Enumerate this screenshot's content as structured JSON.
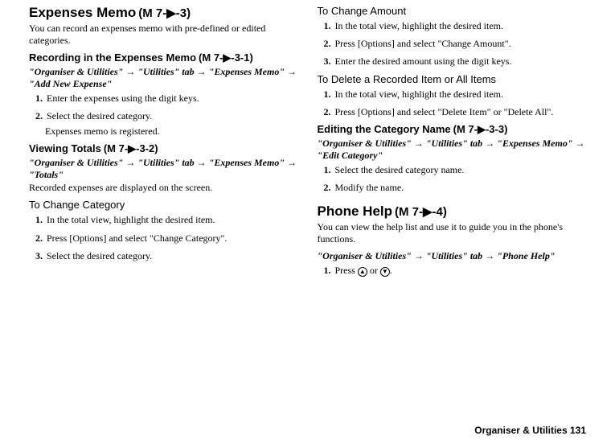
{
  "left": {
    "title": "Expenses Memo",
    "title_code": "(M 7-▶-3)",
    "intro": "You can record an expenses memo with pre-defined or edited categories.",
    "sec1": {
      "heading": "Recording in the Expenses Memo",
      "code": "(M 7-▶-3-1)",
      "path": "\"Organiser & Utilities\" → \"Utilities\" tab → \"Expenses Memo\" → \"Add New Expense\"",
      "steps": [
        "Enter the expenses using the digit keys.",
        "Select the desired category."
      ],
      "note": "Expenses memo is registered."
    },
    "sec2": {
      "heading": "Viewing Totals",
      "code": "(M 7-▶-3-2)",
      "path": "\"Organiser & Utilities\" → \"Utilities\" tab → \"Expenses Memo\" → \"Totals\"",
      "after": "Recorded expenses are displayed on the screen."
    },
    "sec3": {
      "heading": "To Change Category",
      "steps": [
        "In the total view, highlight the desired item.",
        "Press [Options] and select \"Change Category\".",
        "Select the desired category."
      ]
    }
  },
  "right": {
    "sec1": {
      "heading": "To Change Amount",
      "steps": [
        "In the total view, highlight the desired item.",
        "Press [Options] and select \"Change Amount\".",
        "Enter the desired amount using the digit keys."
      ]
    },
    "sec2": {
      "heading": "To Delete a Recorded Item or All Items",
      "steps": [
        "In the total view, highlight the desired item.",
        "Press [Options] and select \"Delete Item\" or \"Delete All\"."
      ]
    },
    "sec3": {
      "heading": "Editing the Category Name",
      "code": "(M 7-▶-3-3)",
      "path": "\"Organiser & Utilities\" → \"Utilities\" tab → \"Expenses Memo\" → \"Edit Category\"",
      "steps": [
        "Select the desired category name.",
        "Modify the name."
      ]
    },
    "sec4": {
      "title": "Phone Help",
      "title_code": "(M 7-▶-4)",
      "intro": "You can view the help list and use it to guide you in the phone's functions.",
      "path": "\"Organiser & Utilities\" → \"Utilities\" tab → \"Phone Help\"",
      "step1_prefix": "Press ",
      "step1_mid": " or ",
      "step1_suffix": "."
    }
  },
  "footer": "Organiser & Utilities   131"
}
